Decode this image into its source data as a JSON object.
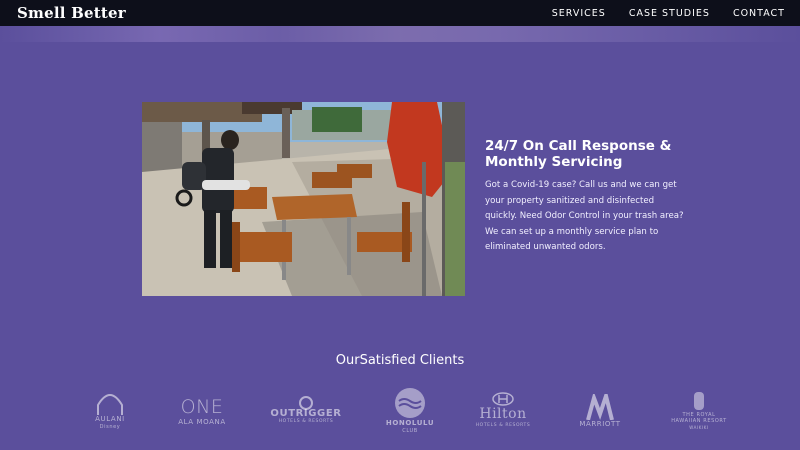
{
  "header": {
    "brand": "Smell Better",
    "nav": [
      "SERVICES",
      "CASE STUDIES",
      "CONTACT"
    ]
  },
  "service": {
    "heading": "24/7 On Call Response & Monthly Servicing",
    "description": "Got a Covid-19 case? Call us and we can get your property sanitized and disinfected quickly. Need Odor Control in your trash area? We can set up a monthly service plan to eliminated unwanted odors."
  },
  "clients": {
    "title": "OurSatisfied Clients",
    "logos": [
      {
        "name": "AULANI",
        "sub": "Disney"
      },
      {
        "name": "ONE",
        "sub": "ALA MOANA"
      },
      {
        "name": "OUTRIGGER",
        "sub": "HOTELS & RESORTS"
      },
      {
        "name": "HONOLULU",
        "sub": "CLUB"
      },
      {
        "name": "Hilton",
        "sub": "HOTELS & RESORTS"
      },
      {
        "name": "MARRIOTT",
        "sub": ""
      },
      {
        "name": "THE ROYAL HAWAIIAN RESORT",
        "sub": "WAIKIKI"
      }
    ]
  },
  "colors": {
    "background": "#5b4f9c",
    "topbar": "#0d0f1a",
    "text": "#ffffff"
  }
}
